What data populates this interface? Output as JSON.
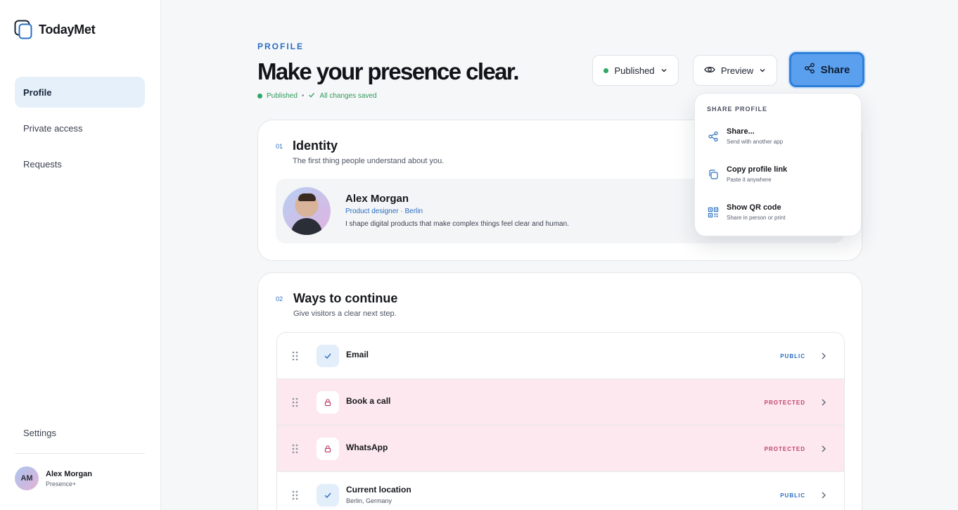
{
  "brand": {
    "name": "TodayMet"
  },
  "sidebar": {
    "items": [
      {
        "label": "Profile",
        "active": true
      },
      {
        "label": "Private access"
      },
      {
        "label": "Requests"
      }
    ],
    "settings_label": "Settings",
    "user": {
      "initials": "AM",
      "name": "Alex Morgan",
      "plan": "Presence+"
    }
  },
  "header": {
    "eyebrow": "PROFILE",
    "title": "Make your presence clear.",
    "status": "Published",
    "separator": "•",
    "saved": "All changes saved",
    "status_dropdown": "Published",
    "preview_label": "Preview",
    "share_label": "Share"
  },
  "identity": {
    "number": "01",
    "title": "Identity",
    "subtitle": "The first thing people understand about you.",
    "name": "Alex Morgan",
    "role": "Product designer · Berlin",
    "bio": "I shape digital products that make complex things feel clear and human."
  },
  "ways": {
    "number": "02",
    "title": "Ways to continue",
    "subtitle": "Give visitors a clear next step.",
    "rows": [
      {
        "label": "Email",
        "sub": "",
        "visibility": "PUBLIC",
        "icon": "check-icon"
      },
      {
        "label": "Book a call",
        "sub": "",
        "visibility": "PROTECTED",
        "icon": "lock-icon"
      },
      {
        "label": "WhatsApp",
        "sub": "",
        "visibility": "PROTECTED",
        "icon": "lock-icon"
      },
      {
        "label": "Current location",
        "sub": "Berlin, Germany",
        "visibility": "PUBLIC",
        "icon": "check-icon"
      }
    ]
  },
  "share_menu": {
    "heading": "SHARE PROFILE",
    "items": [
      {
        "title": "Share...",
        "sub": "Send with another app",
        "icon": "share-icon"
      },
      {
        "title": "Copy profile link",
        "sub": "Paste it anywhere",
        "icon": "copy-icon"
      },
      {
        "title": "Show QR code",
        "sub": "Share in person or print",
        "icon": "qr-code-icon"
      }
    ]
  },
  "colors": {
    "accent": "#2a6fc0",
    "share_button": "#5aa0ee",
    "published_green": "#2fa866",
    "protected_bg": "#fce8ee",
    "protected_text": "#c0406f"
  }
}
